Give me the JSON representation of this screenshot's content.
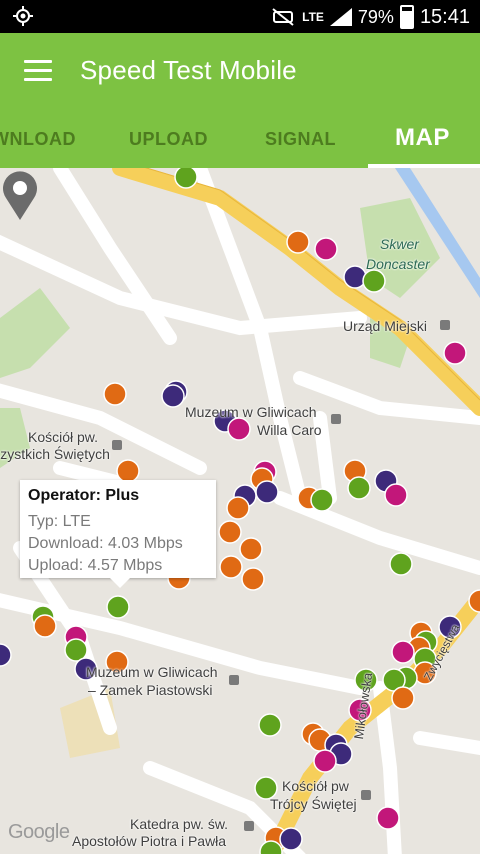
{
  "status_bar": {
    "battery": "79%",
    "time": "15:41",
    "network": "LTE"
  },
  "app": {
    "title": "Speed Test Mobile"
  },
  "tabs": [
    {
      "label": "WNLOAD",
      "active": false
    },
    {
      "label": "UPLOAD",
      "active": false
    },
    {
      "label": "SIGNAL",
      "active": false
    },
    {
      "label": "MAP",
      "active": true
    }
  ],
  "map": {
    "labels": {
      "skwer1": "Skwer",
      "skwer2": "Doncaster",
      "urzad": "Urząd Miejski",
      "muzeum1": "Muzeum w Gliwicach",
      "muzeum2": "Willa Caro",
      "kosciol1": "Kościół pw.",
      "kosciol2": "Wszystkich Świętych",
      "zamek1": "Muzeum w Gliwicach",
      "zamek2": "– Zamek Piastowski",
      "kosciol_trojcy1": "Kościół pw",
      "kosciol_trojcy2": "Trójcy Świętej",
      "katedra1": "Katedra pw. św.",
      "katedra2": "Apostołów Piotra i Pawła",
      "mikolowska": "Mikołowska",
      "zwyciestwa": "Zwycięstwa"
    },
    "attribution": "Google",
    "legend_colors": {
      "green": "#5fa31e",
      "orange": "#e06a14",
      "magenta": "#c2177a",
      "purple": "#3d2a7a"
    },
    "info_window": {
      "operator": "Operator: Plus",
      "type": "Typ: LTE",
      "download": "Download: 4.03 Mbps",
      "upload": "Upload: 4.57 Mbps"
    }
  }
}
